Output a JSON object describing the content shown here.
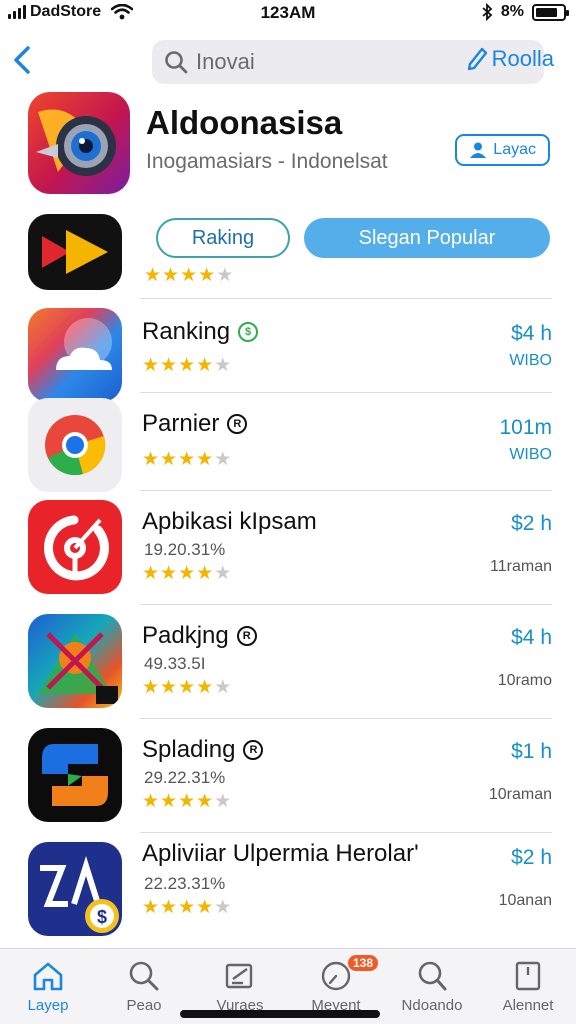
{
  "status_bar": {
    "carrier": "DadStore",
    "time": "123AM",
    "battery": "8%",
    "battery_level": 0.8
  },
  "search": {
    "placeholder": "Inovai",
    "reload_label": "Roolla"
  },
  "hero": {
    "title": "Aldoonasisa",
    "subtitle": "Inogamasiars  -  Indonelsat",
    "chip_label": "Layac"
  },
  "filters": {
    "ranking": "Raking",
    "popular": "Slegan Popular"
  },
  "first_row": {
    "rating": 4
  },
  "apps": [
    {
      "name": "Ranking",
      "badge": "$",
      "meta": "",
      "rating": 4,
      "price": "$4 h",
      "size": "WIBO",
      "size_blue": true
    },
    {
      "name": "Parnier",
      "badge": "R",
      "meta": "",
      "rating": 4,
      "price": "101m",
      "size": "WIBO",
      "size_blue": true
    },
    {
      "name": "Apbikasi kIpsam",
      "badge": "",
      "meta": "19.20.31%",
      "rating": 4,
      "price": "$2 h",
      "size": "11raman",
      "size_blue": false
    },
    {
      "name": "Padkjng",
      "badge": "R",
      "meta": "49.33.5I",
      "rating": 4,
      "price": "$4 h",
      "size": "10ramo",
      "size_blue": false
    },
    {
      "name": "Splading",
      "badge": "R",
      "meta": "29.22.31%",
      "rating": 4,
      "price": "$1 h",
      "size": "10raman",
      "size_blue": false
    },
    {
      "name": "Apliviiar Ulpermia Herolar'",
      "badge": "",
      "meta": "22.23.31%",
      "rating": 4,
      "price": "$2 h",
      "size": "10anan",
      "size_blue": false
    }
  ],
  "tabs": [
    {
      "label": "Layep",
      "icon": "home-icon",
      "active": true
    },
    {
      "label": "Peao",
      "icon": "search-icon",
      "active": false
    },
    {
      "label": "Vuraes",
      "icon": "edit-icon",
      "active": false
    },
    {
      "label": "Meyent",
      "icon": "clock-icon",
      "active": false,
      "badge": "138"
    },
    {
      "label": "Ndoando",
      "icon": "search-icon",
      "active": false
    },
    {
      "label": "Alennet",
      "icon": "bookmark-icon",
      "active": false
    }
  ],
  "colors": {
    "accent": "#1a86e0",
    "star": "#f2b600",
    "popular_pill": "#54aee9",
    "price": "#1a8fc6",
    "tab_badge": "#f05a28"
  }
}
